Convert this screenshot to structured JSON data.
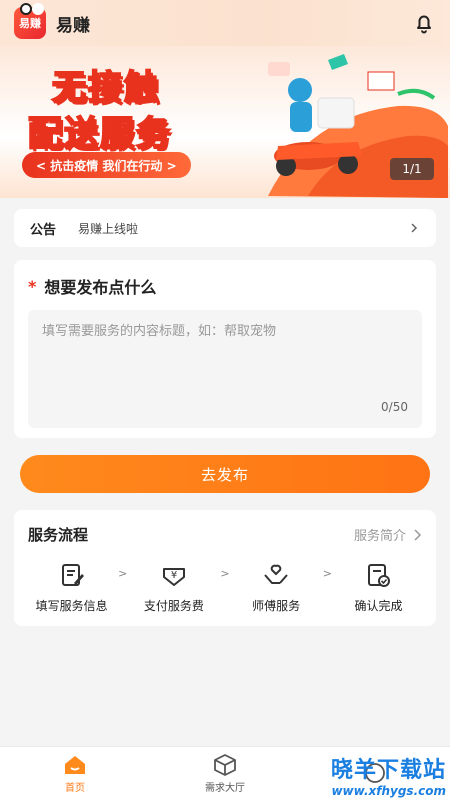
{
  "header": {
    "app_name": "易赚",
    "logo_text": "易赚"
  },
  "banner": {
    "title_line1": "无接触",
    "title_line2": "配送服务",
    "slogan": "< 抗击疫情 我们在行动 >",
    "counter": "1/1"
  },
  "notice": {
    "label": "公告",
    "text": "易赚上线啦"
  },
  "post": {
    "required_mark": "*",
    "heading": "想要发布点什么",
    "placeholder": "填写需要服务的内容标题，如：帮取宠物",
    "counter": "0/50"
  },
  "submit": {
    "label": "去发布"
  },
  "process": {
    "title": "服务流程",
    "intro_link": "服务简介",
    "steps": [
      {
        "label": "填写服务信息",
        "icon": "edit-form-icon"
      },
      {
        "label": "支付服务费",
        "icon": "payment-icon"
      },
      {
        "label": "师傅服务",
        "icon": "service-hands-icon"
      },
      {
        "label": "确认完成",
        "icon": "confirm-check-icon"
      }
    ],
    "separator": ">"
  },
  "tabbar": {
    "tabs": [
      {
        "label": "首页",
        "active": true
      },
      {
        "label": "需求大厅",
        "active": false
      },
      {
        "label": "",
        "active": false
      }
    ]
  },
  "watermark": {
    "main": "晓羊下载站",
    "sub": "www.xfhygs.com"
  },
  "colors": {
    "accent": "#ff7a18",
    "brand_red": "#e8321e",
    "background": "#f4f4f4"
  }
}
